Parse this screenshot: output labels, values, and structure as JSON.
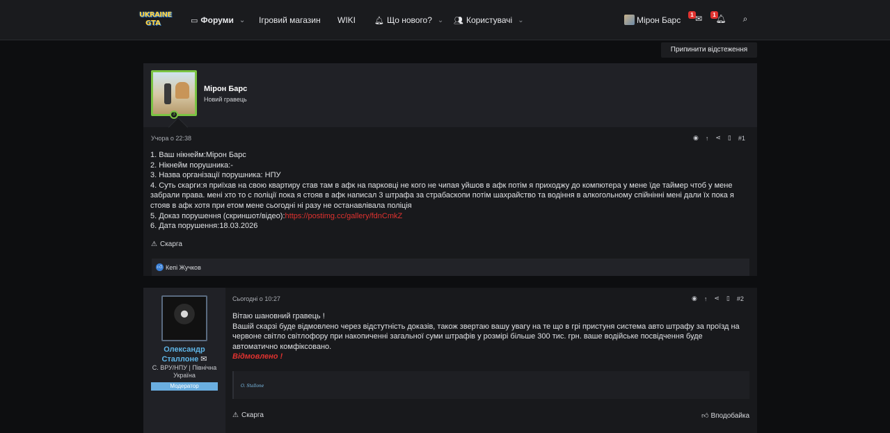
{
  "nav": {
    "logo_line1": "UKRAINE",
    "logo_line2": "GTA",
    "forums": "Форуми",
    "shop": "Ігровий магазин",
    "wiki": "WIKI",
    "news": "Що нового?",
    "users": "Користувачі",
    "username": "Мірон Барс",
    "mail_badge": "1",
    "bell_badge": "1"
  },
  "thread": {
    "unfollow_label": "Припинити відстеження"
  },
  "post1": {
    "author": "Мірон Барс",
    "author_title": "Новий гравець",
    "avatar_level": "3",
    "time": "Учора о 22:38",
    "number": "#1",
    "lines": [
      "1. Ваш нікнейм:Мірон Барс",
      "2. Нікнейм порушника:-",
      "3. Назва організації порушника: НПУ",
      "4. Суть скарги:я приїхав на свою квартиру став там в афк на парковці не кого не чипая уйшов в афк потім я приходжу до компютера у мене їде таймер чтоб у мене забрали права. мені хто то с поліції пока я стояв в афк написал 3 штрафа за страбаскопи потім шахрайство та водіння в алкогольному спійнінні мені дали їх пока я стояв в афк хотя при етом мене сьогодні ні разу не останавлівала поліція",
      "5. Доказ порушення (скриншот/відео):",
      "6. Дата порушення:18.03.2026"
    ],
    "proof_link": "https://postimg.cc/gallery/fdnCmkZ",
    "report_label": "Скарга",
    "reaction_user": "Кепі Жучков"
  },
  "post2": {
    "author": "Олександр Сталлоне",
    "author_line1": "Олександр",
    "author_line2": "Сталлоне",
    "author_sub": "С. ВРУ/НПУ | Північна Україна",
    "role": "Модератор",
    "time": "Сьогодні о 10:27",
    "number": "#2",
    "greeting": "Вітаю шановний гравець !",
    "text": "Вашій скарзі буде відмовлено через відстутність доказів, також звертаю вашу увагу на те що в грі пристуня система авто штрафу за проїзд на червоне світло світлофору при накопиченні загальної суми штрафів у розмірі більше 300 тис. грн. ваше водійське посвідчення буде автоматично комфіксовано.",
    "verdict": "Відмовлено !",
    "signature": "O. Stallone",
    "report_label": "Скарга",
    "like_label": "Вподобайка"
  },
  "colors": {
    "accent_red": "#e0322f",
    "moderator_blue": "#5fb6e8",
    "online_green": "#7bc443"
  }
}
